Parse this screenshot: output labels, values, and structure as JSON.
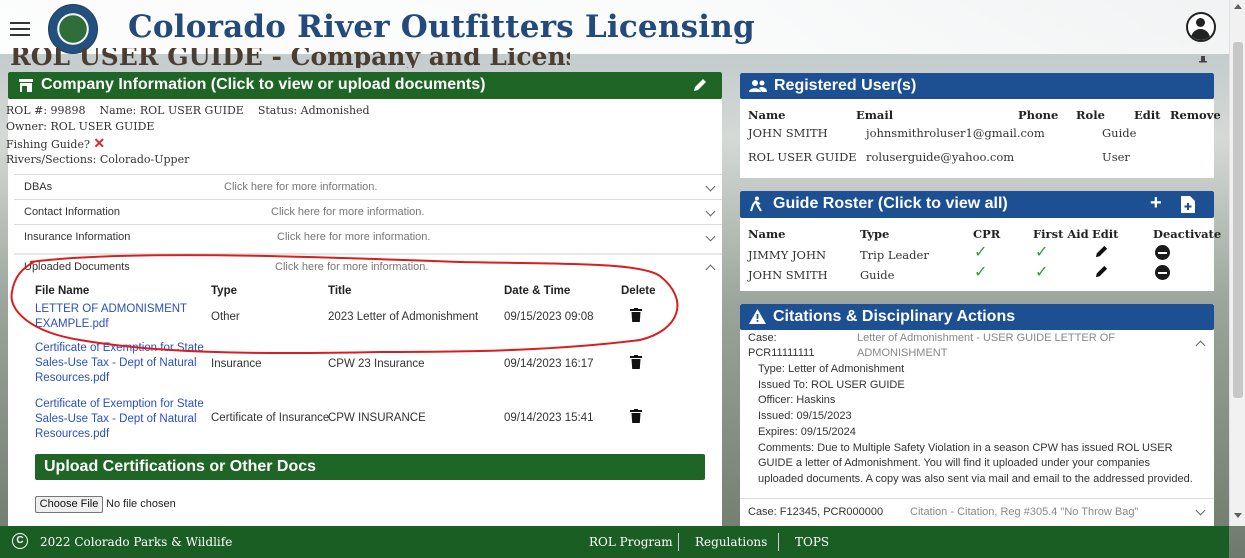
{
  "app": {
    "title": "Colorado River Outfitters Licensing",
    "page_heading": "ROL USER GUIDE - Company and License Information"
  },
  "icons": {
    "menu": "hamburger-icon",
    "logo": "colorado-parks-wildlife-logo",
    "account": "account-circle-icon"
  },
  "company": {
    "header": "Company Information (Click to view or upload documents)",
    "rol_label": "ROL #: 99898",
    "name_label": "Name: ROL USER GUIDE",
    "status_label": "Status: Admonished",
    "owner_label": "Owner: ROL USER GUIDE",
    "fishing_label": "Fishing Guide?",
    "rivers_label": "Rivers/Sections: Colorado-Upper",
    "sections": [
      {
        "label": "DBAs",
        "hint": "Click here for more information."
      },
      {
        "label": "Contact Information",
        "hint": "Click here for more information."
      },
      {
        "label": "Insurance Information",
        "hint": "Click here for more information."
      },
      {
        "label": "Uploaded Documents",
        "hint": "Click here for more information."
      }
    ],
    "docs_headers": {
      "file": "File Name",
      "type": "Type",
      "title": "Title",
      "date": "Date & Time",
      "del": "Delete"
    },
    "docs": [
      {
        "file": "LETTER OF ADMONISMENT EXAMPLE.pdf",
        "type": "Other",
        "title": "2023 Letter of Admonishment",
        "date": "09/15/2023 09:08"
      },
      {
        "file": "Certificate of Exemption for State Sales-Use Tax - Dept of Natural Resources.pdf",
        "type": "Insurance",
        "title": "CPW 23 Insurance",
        "date": "09/14/2023 16:17"
      },
      {
        "file": "Certificate of Exemption for State Sales-Use Tax - Dept of Natural Resources.pdf",
        "type": "Certificate of Insurance",
        "title": "CPW INSURANCE",
        "date": "09/14/2023 15:41"
      }
    ],
    "upload_header": "Upload Certifications or Other Docs",
    "choose_file": "Choose File",
    "no_file": "No file chosen"
  },
  "users": {
    "header": "Registered User(s)",
    "headers": {
      "name": "Name",
      "email": "Email",
      "phone": "Phone",
      "role": "Role",
      "edit": "Edit",
      "remove": "Remove"
    },
    "rows": [
      {
        "name": "JOHN SMITH",
        "email": "johnsmithroluser1@gmail.com",
        "role": "Guide"
      },
      {
        "name": "ROL USER GUIDE",
        "email": "roluserguide@yahoo.com",
        "role": "User"
      }
    ]
  },
  "roster": {
    "header": "Guide Roster (Click to view all)",
    "headers": {
      "name": "Name",
      "type": "Type",
      "cpr": "CPR",
      "first_aid": "First Aid",
      "edit": "Edit",
      "deactivate": "Deactivate"
    },
    "rows": [
      {
        "name": "JIMMY JOHN",
        "type": "Trip Leader"
      },
      {
        "name": "JOHN SMITH",
        "type": "Guide"
      }
    ]
  },
  "citations": {
    "header": "Citations & Disciplinary Actions",
    "case1_label": "Case:",
    "case1_id": "PCR11111111",
    "case1_desc1": "Letter of Admonishment - USER GUIDE LETTER OF",
    "case1_desc2": "ADMONISHMENT",
    "type": "Type: Letter of Admonishment",
    "issued_to": "Issued To: ROL USER GUIDE",
    "officer": "Officer: Haskins",
    "issued": "Issued: 09/15/2023",
    "expires": "Expires: 09/15/2024",
    "comments1": "Comments: Due to Multiple Safety Violation in a season CPW has issued ROL USER",
    "comments2": "GUIDE a letter of Admonishment. You will find it uploaded under your companies",
    "comments3": "uploaded documents. A copy was also sent via mail and email to the addressed provided.",
    "case2": "Case: F12345, PCR000000",
    "case2_desc": "Citation - Citation, Reg #305.4 \"No Throw Bag\""
  },
  "footer": {
    "copyright": "2022 Colorado Parks & Wildlife",
    "links": [
      "ROL Program",
      "Regulations",
      "TOPS"
    ]
  },
  "colors": {
    "green": "#1f6526",
    "blue": "#1d4f93",
    "link": "#2a4fc4",
    "red_annotation": "#d81e1e"
  }
}
